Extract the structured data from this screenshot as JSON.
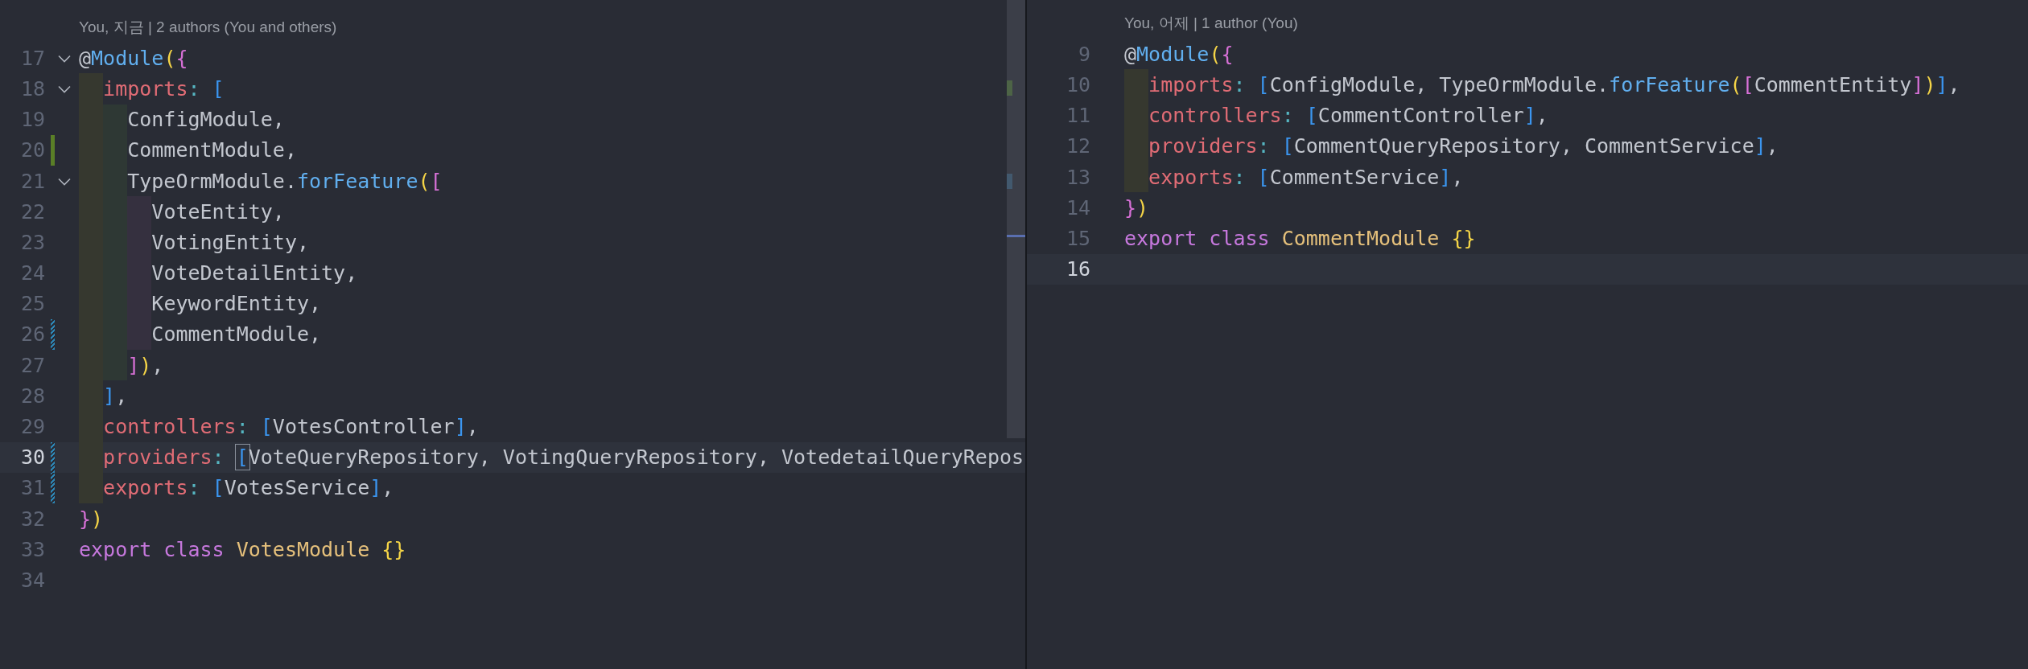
{
  "panes": [
    {
      "lines": [
        {
          "kind": "codelens",
          "text": "You, 지금 | 2 authors (You and others)"
        },
        {
          "kind": "code",
          "number": "17",
          "fold": true,
          "code": [
            {
              "t": "@",
              "kind": "plain"
            },
            {
              "t": "Module",
              "kind": "fn"
            },
            {
              "t": "(",
              "kind": "b1"
            },
            {
              "t": "{",
              "kind": "b2"
            }
          ]
        },
        {
          "kind": "code",
          "number": "18",
          "fold": true,
          "code": [
            {
              "t": "  imports",
              "kind": "key"
            },
            {
              "t": ": ",
              "kind": "punct"
            },
            {
              "t": "[",
              "kind": "b3"
            }
          ]
        },
        {
          "kind": "code",
          "number": "19",
          "code": [
            {
              "t": "    ConfigModule,",
              "kind": "plain"
            }
          ]
        },
        {
          "kind": "code",
          "number": "20",
          "added": true,
          "code": [
            {
              "t": "    CommentModule,",
              "kind": "plain"
            }
          ]
        },
        {
          "kind": "code",
          "number": "21",
          "fold": true,
          "code": [
            {
              "t": "    TypeOrmModule.",
              "kind": "plain"
            },
            {
              "t": "forFeature",
              "kind": "fn"
            },
            {
              "t": "(",
              "kind": "b1"
            },
            {
              "t": "[",
              "kind": "b2"
            }
          ]
        },
        {
          "kind": "code",
          "number": "22",
          "code": [
            {
              "t": "      VoteEntity,",
              "kind": "plain"
            }
          ]
        },
        {
          "kind": "code",
          "number": "23",
          "code": [
            {
              "t": "      VotingEntity,",
              "kind": "plain"
            }
          ]
        },
        {
          "kind": "code",
          "number": "24",
          "code": [
            {
              "t": "      VoteDetailEntity,",
              "kind": "plain"
            }
          ]
        },
        {
          "kind": "code",
          "number": "25",
          "code": [
            {
              "t": "      KeywordEntity,",
              "kind": "plain"
            }
          ]
        },
        {
          "kind": "code",
          "number": "26",
          "modified": true,
          "code": [
            {
              "t": "      CommentModule,",
              "kind": "plain"
            }
          ]
        },
        {
          "kind": "code",
          "number": "27",
          "code": [
            {
              "t": "    ]",
              "kind": "b2"
            },
            {
              "t": ")",
              "kind": "b1"
            },
            {
              "t": ",",
              "kind": "plain"
            }
          ]
        },
        {
          "kind": "code",
          "number": "28",
          "code": [
            {
              "t": "  ]",
              "kind": "b3"
            },
            {
              "t": ",",
              "kind": "plain"
            }
          ]
        },
        {
          "kind": "code",
          "number": "29",
          "code": [
            {
              "t": "  controllers",
              "kind": "key"
            },
            {
              "t": ": ",
              "kind": "punct"
            },
            {
              "t": "[",
              "kind": "b3"
            },
            {
              "t": "VotesController",
              "kind": "plain"
            },
            {
              "t": "]",
              "kind": "b3"
            },
            {
              "t": ",",
              "kind": "plain"
            }
          ]
        },
        {
          "kind": "code",
          "number": "30",
          "modified": true,
          "current": true,
          "code": [
            {
              "t": "  providers",
              "kind": "key"
            },
            {
              "t": ": ",
              "kind": "punct"
            },
            {
              "t": "[",
              "kind": "b3",
              "cursor": true
            },
            {
              "t": "VoteQueryRepository, VotingQueryRepository, VotedetailQueryRepos",
              "kind": "plain"
            }
          ]
        },
        {
          "kind": "code",
          "number": "31",
          "modified": true,
          "code": [
            {
              "t": "  exports",
              "kind": "key"
            },
            {
              "t": ": ",
              "kind": "punct"
            },
            {
              "t": "[",
              "kind": "b3"
            },
            {
              "t": "VotesService",
              "kind": "plain"
            },
            {
              "t": "]",
              "kind": "b3"
            },
            {
              "t": ",",
              "kind": "plain"
            }
          ]
        },
        {
          "kind": "code",
          "number": "32",
          "code": [
            {
              "t": "}",
              "kind": "b2"
            },
            {
              "t": ")",
              "kind": "b1"
            }
          ]
        },
        {
          "kind": "code",
          "number": "33",
          "code": [
            {
              "t": "export class ",
              "kind": "keyword"
            },
            {
              "t": "VotesModule ",
              "kind": "type"
            },
            {
              "t": "{}",
              "kind": "b1"
            }
          ]
        },
        {
          "kind": "code",
          "number": "34"
        }
      ]
    },
    {
      "lines": [
        {
          "kind": "codelens",
          "text": "You, 어제 | 1 author (You)"
        },
        {
          "kind": "code",
          "number": "9",
          "code": [
            {
              "t": "@",
              "kind": "plain"
            },
            {
              "t": "Module",
              "kind": "fn"
            },
            {
              "t": "(",
              "kind": "b1"
            },
            {
              "t": "{",
              "kind": "b2"
            }
          ]
        },
        {
          "kind": "code",
          "number": "10",
          "code": [
            {
              "t": "  imports",
              "kind": "key"
            },
            {
              "t": ": ",
              "kind": "punct"
            },
            {
              "t": "[",
              "kind": "b3"
            },
            {
              "t": "ConfigModule, TypeOrmModule.",
              "kind": "plain"
            },
            {
              "t": "forFeature",
              "kind": "fn"
            },
            {
              "t": "(",
              "kind": "b1"
            },
            {
              "t": "[",
              "kind": "b2"
            },
            {
              "t": "CommentEntity",
              "kind": "plain"
            },
            {
              "t": "]",
              "kind": "b2"
            },
            {
              "t": ")",
              "kind": "b1"
            },
            {
              "t": "]",
              "kind": "b3"
            },
            {
              "t": ",",
              "kind": "plain"
            }
          ]
        },
        {
          "kind": "code",
          "number": "11",
          "code": [
            {
              "t": "  controllers",
              "kind": "key"
            },
            {
              "t": ": ",
              "kind": "punct"
            },
            {
              "t": "[",
              "kind": "b3"
            },
            {
              "t": "CommentController",
              "kind": "plain"
            },
            {
              "t": "]",
              "kind": "b3"
            },
            {
              "t": ",",
              "kind": "plain"
            }
          ]
        },
        {
          "kind": "code",
          "number": "12",
          "code": [
            {
              "t": "  providers",
              "kind": "key"
            },
            {
              "t": ": ",
              "kind": "punct"
            },
            {
              "t": "[",
              "kind": "b3"
            },
            {
              "t": "CommentQueryRepository, CommentService",
              "kind": "plain"
            },
            {
              "t": "]",
              "kind": "b3"
            },
            {
              "t": ",",
              "kind": "plain"
            }
          ]
        },
        {
          "kind": "code",
          "number": "13",
          "code": [
            {
              "t": "  exports",
              "kind": "key"
            },
            {
              "t": ": ",
              "kind": "punct"
            },
            {
              "t": "[",
              "kind": "b3"
            },
            {
              "t": "CommentService",
              "kind": "plain"
            },
            {
              "t": "]",
              "kind": "b3"
            },
            {
              "t": ",",
              "kind": "plain"
            }
          ]
        },
        {
          "kind": "code",
          "number": "14",
          "code": [
            {
              "t": "}",
              "kind": "b2"
            },
            {
              "t": ")",
              "kind": "b1"
            }
          ]
        },
        {
          "kind": "code",
          "number": "15",
          "code": [
            {
              "t": "export class ",
              "kind": "keyword"
            },
            {
              "t": "CommentModule ",
              "kind": "type"
            },
            {
              "t": "{}",
              "kind": "b1"
            }
          ]
        },
        {
          "kind": "code",
          "number": "16",
          "current": true
        }
      ]
    }
  ]
}
